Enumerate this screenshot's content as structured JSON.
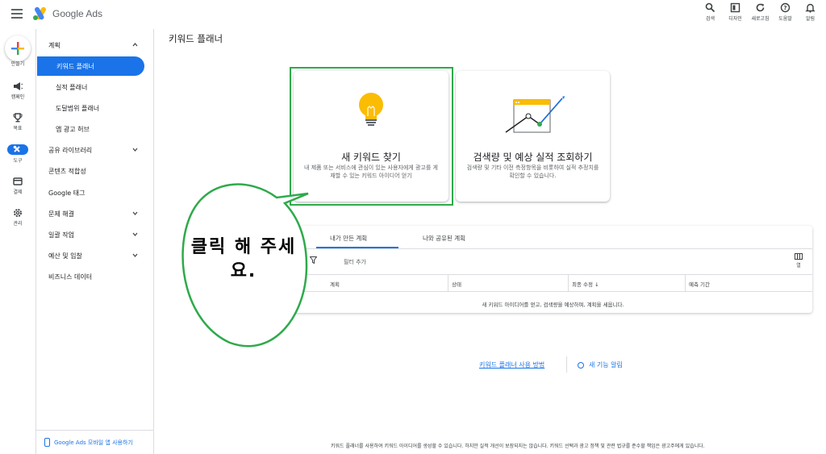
{
  "header": {
    "brand": "Google Ads",
    "actions": [
      {
        "label": "검색",
        "icon": "search-icon"
      },
      {
        "label": "디자인",
        "icon": "appearance-icon"
      },
      {
        "label": "새로고침",
        "icon": "refresh-icon"
      },
      {
        "label": "도움말",
        "icon": "help-icon"
      },
      {
        "label": "알림",
        "icon": "bell-icon"
      }
    ]
  },
  "rail": {
    "items": [
      {
        "label": "만들기",
        "icon": "plus-icon"
      },
      {
        "label": "캠페인",
        "icon": "megaphone-icon"
      },
      {
        "label": "목표",
        "icon": "trophy-icon"
      },
      {
        "label": "도구",
        "icon": "tools-icon",
        "active": true
      },
      {
        "label": "결제",
        "icon": "card-icon"
      },
      {
        "label": "관리",
        "icon": "gear-icon"
      }
    ]
  },
  "nav": {
    "items": [
      {
        "label": "계획",
        "expanded": true
      },
      {
        "label": "키워드 플래너",
        "active": true
      },
      {
        "label": "실적 플래너"
      },
      {
        "label": "도달범위 플래너"
      },
      {
        "label": "앱 광고 허브"
      },
      {
        "label": "공유 라이브러리"
      },
      {
        "label": "콘텐츠 적합성"
      },
      {
        "label": "Google 태그"
      },
      {
        "label": "문제 해결"
      },
      {
        "label": "일괄 작업"
      },
      {
        "label": "예산 및 입찰"
      },
      {
        "label": "비즈니스 데이터"
      }
    ],
    "footer": "Google Ads 모바일 앱 사용하기"
  },
  "main": {
    "title": "키워드 플래너",
    "cards": [
      {
        "title": "새 키워드 찾기",
        "desc": "내 제품 또는 서비스에 관심이 있는 사용자에게 광고를 게재할 수 있는 키워드 아이디어 얻기",
        "icon": "lightbulb-icon"
      },
      {
        "title": "검색량 및 예상 실적 조회하기",
        "desc": "검색량 및 기타 이전 측정항목을 비롯하여 실적 추정치를 확인할 수 있습니다.",
        "icon": "forecast-chart-icon"
      }
    ],
    "tabs": [
      "내가 만든 계획",
      "나와 공유된 계획"
    ],
    "filter_label": "필터 추가",
    "columns_label": "열",
    "table_columns": [
      "계획",
      "상태",
      "최종 수정",
      "예측 기간"
    ],
    "empty_message": "새 키워드 아이디어를 얻고, 검색량을 예상하며, 계획을 세웁니다.",
    "help_link": "키워드 플래너 사용 방법",
    "news_link": "새 기능 알림",
    "disclaimer": "키워드 플래너를 사용하여 키워드 아이디어를 생성할 수 있습니다. 하지만 실적 개선이 보장되지는 않습니다. 키워드 선택과 광고 정책 및 관련 법규를 준수할 책임은 광고주에게 있습니다."
  },
  "annotation": {
    "text": "클릭 해 주세요.",
    "color": "#2eaa4a"
  }
}
